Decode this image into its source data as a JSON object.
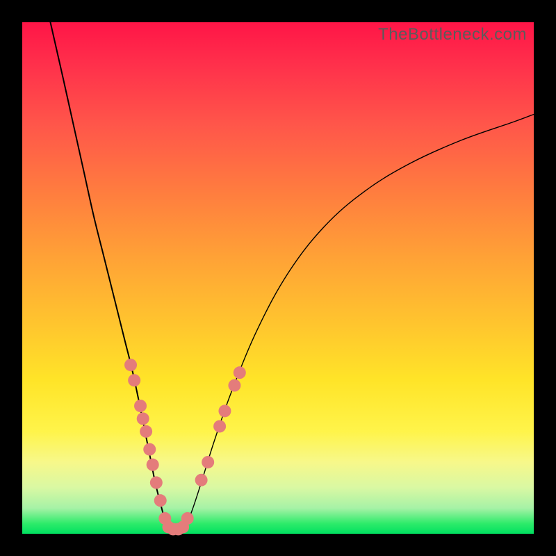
{
  "watermark": "TheBottleneck.com",
  "colors": {
    "frame": "#000000",
    "curve": "#000000",
    "dots": "#e47c7b",
    "gradient_top": "#ff1547",
    "gradient_bottom": "#00e060"
  },
  "chart_data": {
    "type": "line",
    "title": "",
    "xlabel": "",
    "ylabel": "",
    "xlim": [
      0,
      100
    ],
    "ylim": [
      0,
      100
    ],
    "series": [
      {
        "name": "left-branch",
        "x": [
          5.5,
          8,
          10,
          12,
          14,
          16,
          18,
          20,
          21.5,
          23,
          24,
          25,
          26,
          27,
          27.8,
          28.5
        ],
        "y": [
          100,
          89,
          80,
          71,
          62,
          54,
          46,
          38,
          32,
          25,
          20,
          15,
          10,
          6,
          3,
          0.8
        ]
      },
      {
        "name": "floor",
        "x": [
          28.5,
          30,
          31.5
        ],
        "y": [
          0.8,
          0.6,
          0.8
        ]
      },
      {
        "name": "right-branch",
        "x": [
          31.5,
          33,
          35,
          37.5,
          41,
          46,
          52,
          59,
          67,
          76,
          86,
          96,
          100
        ],
        "y": [
          0.8,
          4,
          10,
          18,
          28,
          40,
          51,
          60,
          67,
          72.5,
          77,
          80.5,
          82
        ]
      }
    ],
    "markers": [
      {
        "name": "left-cluster",
        "points": [
          {
            "x": 21.2,
            "y": 33
          },
          {
            "x": 21.9,
            "y": 30
          },
          {
            "x": 23.1,
            "y": 25
          },
          {
            "x": 23.6,
            "y": 22.5
          },
          {
            "x": 24.2,
            "y": 20
          },
          {
            "x": 24.9,
            "y": 16.5
          },
          {
            "x": 25.5,
            "y": 13.5
          },
          {
            "x": 26.2,
            "y": 10
          },
          {
            "x": 27.0,
            "y": 6.5
          }
        ]
      },
      {
        "name": "bottom-cluster",
        "points": [
          {
            "x": 27.9,
            "y": 3.0
          },
          {
            "x": 28.6,
            "y": 1.3
          },
          {
            "x": 29.5,
            "y": 0.9
          },
          {
            "x": 30.5,
            "y": 0.9
          },
          {
            "x": 31.4,
            "y": 1.3
          },
          {
            "x": 32.3,
            "y": 3.0
          }
        ]
      },
      {
        "name": "right-cluster",
        "points": [
          {
            "x": 35.0,
            "y": 10.5
          },
          {
            "x": 36.3,
            "y": 14
          },
          {
            "x": 38.6,
            "y": 21
          },
          {
            "x": 39.6,
            "y": 24
          },
          {
            "x": 41.5,
            "y": 29
          },
          {
            "x": 42.5,
            "y": 31.5
          }
        ]
      }
    ]
  }
}
